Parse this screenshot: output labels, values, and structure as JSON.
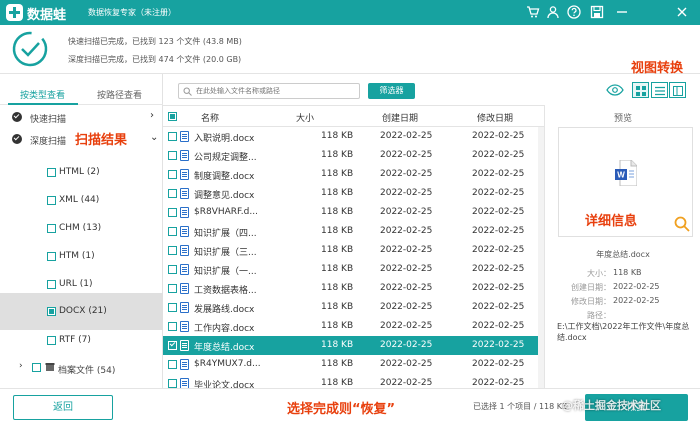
{
  "app": {
    "name": "数据蛙",
    "subtitle": "数据恢复专家（未注册）",
    "accent": "#17a2a0"
  },
  "titlebar_icons": [
    "cart-icon",
    "user-icon",
    "help-icon",
    "save-icon",
    "minimize-icon",
    "close-icon"
  ],
  "scan": {
    "quick_line": "快速扫描已完成，已找到 123 个文件 (43.8 MB)",
    "deep_line": "深度扫描已完成，已找到 474 个文件 (20.0 GB)"
  },
  "sidebar": {
    "tabs": [
      "按类型查看",
      "按路径查看"
    ],
    "active_tab": 0,
    "scans": [
      {
        "label": "快速扫描",
        "arrow": "›"
      },
      {
        "label": "深度扫描",
        "arrow": "⌄"
      }
    ],
    "types": [
      {
        "label": "HTML (2)",
        "checked": false,
        "selected": false
      },
      {
        "label": "XML (44)",
        "checked": false,
        "selected": false
      },
      {
        "label": "CHM (13)",
        "checked": false,
        "selected": false
      },
      {
        "label": "HTM (1)",
        "checked": false,
        "selected": false
      },
      {
        "label": "URL (1)",
        "checked": false,
        "selected": false
      },
      {
        "label": "DOCX (21)",
        "checked": true,
        "selected": true
      },
      {
        "label": "RTF (7)",
        "checked": false,
        "selected": false
      }
    ],
    "archive": {
      "label": "档案文件 (54)",
      "arrow": "›"
    }
  },
  "annotations": {
    "scan_results": "扫描结果",
    "view_switch": "视图转换",
    "details": "详细信息",
    "recover_hint": "选择完成则“恢复”"
  },
  "toolbar": {
    "search_placeholder": "在此处输入文件名称或路径",
    "filter_label": "筛选器"
  },
  "table": {
    "headers": {
      "name": "名称",
      "size": "大小",
      "created": "创建日期",
      "modified": "修改日期"
    },
    "rows": [
      {
        "name": "入职说明.docx",
        "size": "118 KB",
        "created": "2022-02-25",
        "modified": "2022-02-25",
        "selected": false
      },
      {
        "name": "公司规定调整...",
        "size": "118 KB",
        "created": "2022-02-25",
        "modified": "2022-02-25",
        "selected": false
      },
      {
        "name": "制度调整.docx",
        "size": "118 KB",
        "created": "2022-02-25",
        "modified": "2022-02-25",
        "selected": false
      },
      {
        "name": "调整意见.docx",
        "size": "118 KB",
        "created": "2022-02-25",
        "modified": "2022-02-25",
        "selected": false
      },
      {
        "name": "$R8VHARF.d...",
        "size": "118 KB",
        "created": "2022-02-25",
        "modified": "2022-02-25",
        "selected": false
      },
      {
        "name": "知识扩展（四...",
        "size": "118 KB",
        "created": "2022-02-25",
        "modified": "2022-02-25",
        "selected": false
      },
      {
        "name": "知识扩展（三...",
        "size": "118 KB",
        "created": "2022-02-25",
        "modified": "2022-02-25",
        "selected": false
      },
      {
        "name": "知识扩展（一...",
        "size": "118 KB",
        "created": "2022-02-25",
        "modified": "2022-02-25",
        "selected": false
      },
      {
        "name": "工资数据表格...",
        "size": "118 KB",
        "created": "2022-02-25",
        "modified": "2022-02-25",
        "selected": false
      },
      {
        "name": "发展路线.docx",
        "size": "118 KB",
        "created": "2022-02-25",
        "modified": "2022-02-25",
        "selected": false
      },
      {
        "name": "工作内容.docx",
        "size": "118 KB",
        "created": "2022-02-25",
        "modified": "2022-02-25",
        "selected": false
      },
      {
        "name": "年度总结.docx",
        "size": "118 KB",
        "created": "2022-02-25",
        "modified": "2022-02-25",
        "selected": true
      },
      {
        "name": "$R4YMUX7.d...",
        "size": "118 KB",
        "created": "2022-02-25",
        "modified": "2022-02-25",
        "selected": false
      },
      {
        "name": "毕业论文.docx",
        "size": "118 KB",
        "created": "2022-02-25",
        "modified": "2022-02-25",
        "selected": false
      }
    ]
  },
  "preview": {
    "title": "预览",
    "filename": "年度总结.docx",
    "size_key": "大小：",
    "size_val": "118 KB",
    "created_key": "创建日期：",
    "created_val": "2022-02-25",
    "modified_key": "修改日期：",
    "modified_val": "2022-02-25",
    "path_key": "路径：",
    "path_val": "E:\\工作文档\\2022年工作文件\\年度总结.docx"
  },
  "footer": {
    "back_label": "返回",
    "selection_info": "已选择 1 个项目 / 118 KB",
    "recover_label": "恢复",
    "watermark": "@稀土掘金技术社区"
  }
}
